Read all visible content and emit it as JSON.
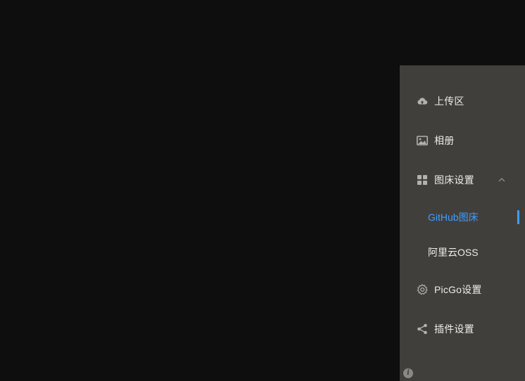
{
  "sidebar": {
    "items": [
      {
        "label": "上传区",
        "icon": "cloud-upload-icon"
      },
      {
        "label": "相册",
        "icon": "picture-icon"
      },
      {
        "label": "图床设置",
        "icon": "grid-menu-icon",
        "expanded": true,
        "children": [
          {
            "label": "GitHub图床",
            "active": true
          },
          {
            "label": "阿里云OSS",
            "active": false
          }
        ]
      },
      {
        "label": "PicGo设置",
        "icon": "gear-icon"
      },
      {
        "label": "插件设置",
        "icon": "share-icon"
      }
    ],
    "info_glyph": "i"
  },
  "colors": {
    "background": "#0e0e0e",
    "sidebar": "#413f3b",
    "text": "#ececec",
    "icon": "#b3b1ad",
    "accent": "#409eff"
  }
}
